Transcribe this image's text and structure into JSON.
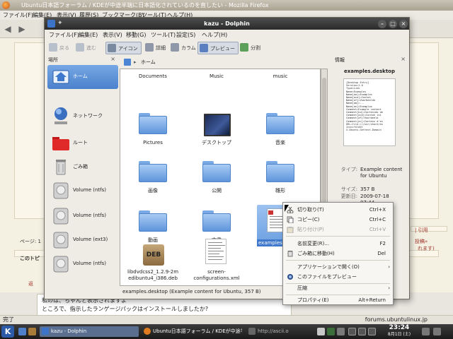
{
  "firefox": {
    "title": "Ubuntu日本語フォーラム / KDEが中途半端に日本語化されているのを直したい - Mozilla Firefox",
    "menu": [
      "ファイル(F)",
      "編集(E)",
      "表示(V)",
      "履歴(S)",
      "ブックマーク(B)",
      "ツール(T)",
      "ヘルプ(H)"
    ],
    "page_label": "ページ: 1",
    "topic_label": "このトピ",
    "reply_label": "返",
    "quote_lines": [
      "私のは、ちゃんと表示されますよ",
      "ところで、指示したランゲージパックはインストールしましたか?"
    ],
    "right_links": [
      "| 引用",
      "投稿»",
      "れます)"
    ],
    "status_left": "完了",
    "status_right": "forums.ubuntulinux.jp"
  },
  "dolphin": {
    "title": "kazu - Dolphin",
    "menu": [
      "ファイル(F)",
      "編集(E)",
      "表示(V)",
      "移動(G)",
      "ツール(T)",
      "設定(S)",
      "ヘルプ(H)"
    ],
    "toolbar": {
      "back": "戻る",
      "forward": "進む",
      "icons": "アイコン",
      "details": "詳細",
      "columns": "カラム",
      "preview": "プレビュー",
      "split": "分割"
    },
    "breadcrumb": "ホーム",
    "places": {
      "header": "場所",
      "items": [
        "ホーム",
        "ネットワーク",
        "ルート",
        "ごみ箱",
        "Volume (ntfs)",
        "Volume (ntfs)",
        "Volume (ext3)",
        "Volume (ntfs)"
      ]
    },
    "files": {
      "row0": [
        "Documents",
        "Music",
        "music"
      ],
      "row1": [
        "Pictures",
        "デスクトップ",
        "音楽"
      ],
      "row2": [
        "画像",
        "公開",
        "雛形"
      ],
      "row3": [
        "動画",
        "文書",
        "examples."
      ],
      "deb": [
        "libdvdcss2_1.2.9-2m",
        "edibuntu4_i386.deb"
      ],
      "screen": [
        "screen-",
        "configurations.xml"
      ]
    },
    "statusbar": "examples.desktop (Example content for Ubuntu, 357 B)",
    "info": {
      "header": "情報",
      "filename": "examples.desktop",
      "preview_lines": [
        "[Desktop Entry]",
        "Version=1.0",
        "Type=Link",
        "Name=Examples",
        "Name[aa]=Examples",
        "Name[ace]=Contoh",
        "Name[af]=Voorbeelde",
        "Name[am]=...",
        "Name[an]=Exemplos",
        "Comment=Example content",
        "Comment[ko]=Contenido de",
        "Comment[ace]=Contoh isi",
        "Comment[af]=Voorbeeld",
        "Comment[ar]=Contenu d'ex",
        "URL=file:///usr/share/ex",
        "Icon=folder",
        "X-Ubuntu-Gettext-Domain"
      ],
      "type_label": "タイプ:",
      "type_value": "Example content for Ubuntu",
      "size_label": "サイズ:",
      "size_value": "357 B",
      "modified_label": "更新日:",
      "modified_value": "2009-07-18 07:44"
    }
  },
  "context_menu": {
    "items": [
      {
        "label": "切り取り(T)",
        "shortcut": "Ctrl+X"
      },
      {
        "label": "コピー(C)",
        "shortcut": "Ctrl+C"
      },
      {
        "label": "貼り付け(P)",
        "shortcut": "Ctrl+V"
      },
      {
        "label": "名前変更(R)...",
        "shortcut": "F2"
      },
      {
        "label": "ごみ箱に移動(H)",
        "shortcut": "Del"
      },
      {
        "label": "アプリケーションで開く(O)",
        "shortcut": ""
      },
      {
        "label": "このファイルをプレビュー",
        "shortcut": ""
      },
      {
        "label": "圧縮",
        "shortcut": ""
      },
      {
        "label": "プロパティ(E)",
        "shortcut": "Alt+Return"
      }
    ]
  },
  "taskbar": {
    "tasks": [
      "kazu - Dolphin",
      "Ubuntu日本語フォーラム / KDEが中途半端"
    ],
    "search_text": "http://ascii.o",
    "time": "23:24",
    "date": "8月1日 (土)"
  }
}
